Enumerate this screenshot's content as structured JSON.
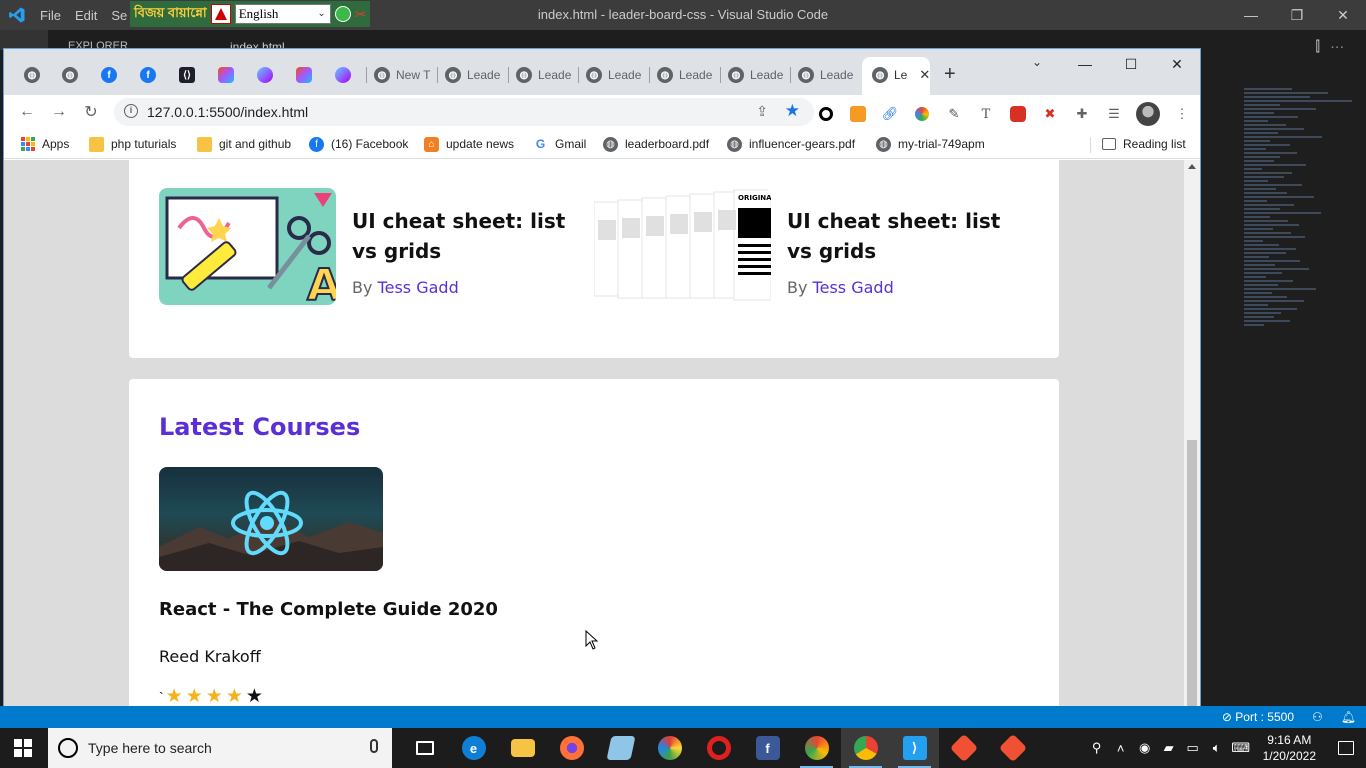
{
  "vscode": {
    "menu": [
      "File",
      "Edit",
      "Se"
    ],
    "title": "index.html - leader-board-css - Visual Studio Code",
    "explorer_label": "EXPLORER",
    "tab_fragment": "index.html",
    "status": {
      "port": "Port : 5500"
    },
    "accent": "#007acc"
  },
  "lang_widget": {
    "brand": "বিজয় বায়ান্নো",
    "selected": "English"
  },
  "chrome": {
    "tabs": [
      {
        "label": "",
        "icon": "globe-icon"
      },
      {
        "label": "",
        "icon": "globe-icon"
      },
      {
        "label": "",
        "icon": "facebook-icon"
      },
      {
        "label": "",
        "icon": "facebook-icon"
      },
      {
        "label": "",
        "icon": "code-icon"
      },
      {
        "label": "",
        "icon": "figma-icon"
      },
      {
        "label": "",
        "icon": "figma-icon"
      },
      {
        "label": "",
        "icon": "figma-icon"
      },
      {
        "label": "",
        "icon": "figma-icon"
      },
      {
        "label": "New T",
        "icon": "globe-icon"
      },
      {
        "label": "Leade",
        "icon": "globe-icon"
      },
      {
        "label": "Leade",
        "icon": "globe-icon"
      },
      {
        "label": "Leade",
        "icon": "globe-icon"
      },
      {
        "label": "Leade",
        "icon": "globe-icon"
      },
      {
        "label": "Leade",
        "icon": "globe-icon"
      },
      {
        "label": "Leade",
        "icon": "globe-icon"
      }
    ],
    "active_tab": "Le",
    "url": "127.0.0.1:5500/index.html",
    "bookmarks": [
      {
        "label": "Apps",
        "icon": "apps-icon"
      },
      {
        "label": "php tuturials",
        "icon": "folder-icon"
      },
      {
        "label": "git and github",
        "icon": "folder-icon"
      },
      {
        "label": "(16) Facebook",
        "icon": "facebook-icon"
      },
      {
        "label": "update news",
        "icon": "news-icon"
      },
      {
        "label": "Gmail",
        "icon": "google-icon"
      },
      {
        "label": "leaderboard.pdf",
        "icon": "globe-icon"
      },
      {
        "label": "influencer-gears.pdf",
        "icon": "globe-icon"
      },
      {
        "label": "my-trial-749apm",
        "icon": "globe-icon"
      }
    ],
    "reading_list": "Reading list"
  },
  "page": {
    "articles": [
      {
        "title": "UI cheat sheet: list vs grids",
        "by": "By",
        "author": "Tess Gadd"
      },
      {
        "title": "UI cheat sheet: list vs grids",
        "by": "By",
        "author": "Tess Gadd"
      }
    ],
    "latest_title": "Latest Courses",
    "course": {
      "title": "React - The Complete Guide 2020",
      "author": "Reed Krakoff",
      "prefix": "`",
      "rating": 4,
      "rating_max": 5
    },
    "accent": "#5b2fd6",
    "star_color": "#f5b21c"
  },
  "taskbar": {
    "search_placeholder": "Type here to search",
    "time": "9:16 AM",
    "date": "1/20/2022"
  }
}
